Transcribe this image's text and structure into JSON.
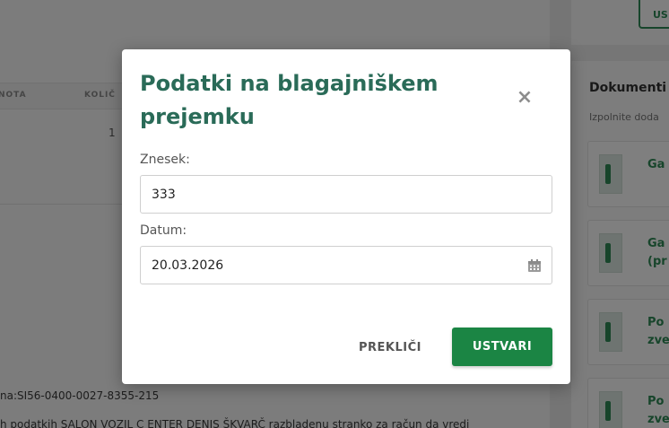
{
  "background": {
    "table_headers": [
      "NOTA",
      "KOLIČ"
    ],
    "table_cell": "1",
    "text_lines": [
      "na:SI56-0400-0027-8355-215",
      "h podatkih SALON VOZIL C ENTER DENIS ŠKVARČ razbladenu stranko za račun da vredi"
    ],
    "side_button": "US",
    "side_title": "Dokumenti",
    "side_subtitle": "Izpolnite doda",
    "side_cards": [
      "Ga",
      "Ga\n(pr",
      "Po\nzve",
      "Po\nzve"
    ]
  },
  "modal": {
    "title": "Podatki na blagajniškem prejemku",
    "amount_label": "Znesek:",
    "amount_value": "333",
    "date_label": "Datum:",
    "date_value": "20.03.2026",
    "cancel_label": "PREKLIČI",
    "create_label": "USTVARI",
    "close_icon": "close-icon",
    "calendar_icon": "calendar-icon"
  },
  "colors": {
    "title": "#2a6b58",
    "primary_button": "#1b8544",
    "overlay": "rgba(0,0,0,0.5)"
  }
}
